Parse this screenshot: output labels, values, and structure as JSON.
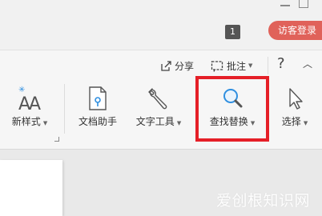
{
  "titlebar": {
    "badge": "1",
    "login_label": "访客登录"
  },
  "ribbon": {
    "share_label": "分享",
    "comment_label": "批注",
    "help_symbol": "?",
    "collapse_symbol": "︿",
    "tools": {
      "new_style": "新样式",
      "doc_assistant": "文档助手",
      "text_tools": "文字工具",
      "find_replace": "查找替换",
      "select": "选择"
    }
  },
  "watermark": "爱创根知识网",
  "colors": {
    "highlight": "#e51f27",
    "login_bg": "#e0625a",
    "accent_blue": "#2f8fe0"
  }
}
